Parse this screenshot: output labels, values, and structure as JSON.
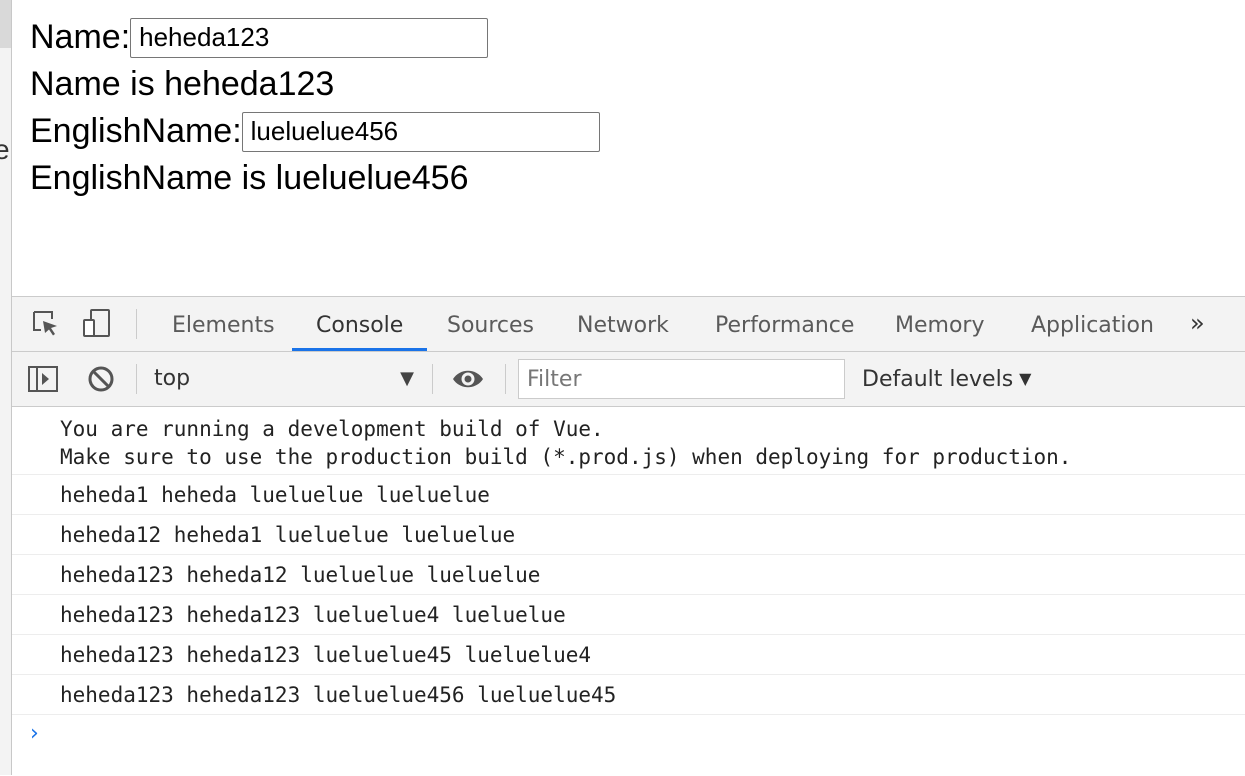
{
  "page": {
    "name_label": "Name:",
    "name_value": "heheda123",
    "name_display": "Name is heheda123",
    "ename_label": "EnglishName:",
    "ename_value": "lueluelue456",
    "ename_display": "EnglishName is lueluelue456"
  },
  "edge": {
    "cut_glyph": "e"
  },
  "devtools": {
    "tabs": [
      "Elements",
      "Console",
      "Sources",
      "Network",
      "Performance",
      "Memory",
      "Application"
    ],
    "active_tab": "Console",
    "more_tabs_label": "»",
    "context": "top",
    "filter_placeholder": "Filter",
    "levels_label": "Default levels",
    "icons": [
      "inspect-element-icon",
      "device-toolbar-icon",
      "sidebar-toggle-icon",
      "clear-console-icon",
      "eye-icon",
      "dropdown-arrow-icon",
      "chevron-right-icon"
    ],
    "accent_color": "#1a73e8"
  },
  "console": {
    "vue_notice_line1": "You are running a development build of Vue.",
    "vue_notice_line2": "Make sure to use the production build (*.prod.js) when deploying for production.",
    "logs": [
      "heheda1 heheda lueluelue lueluelue",
      "heheda12 heheda1 lueluelue lueluelue",
      "heheda123 heheda12 lueluelue lueluelue",
      "heheda123 heheda123 lueluelue4 lueluelue",
      "heheda123 heheda123 lueluelue45 lueluelue4",
      "heheda123 heheda123 lueluelue456 lueluelue45"
    ],
    "prompt": "›"
  }
}
